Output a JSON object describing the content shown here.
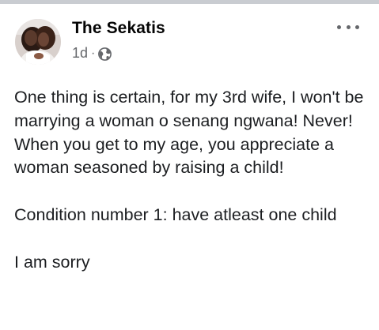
{
  "post": {
    "author": "The Sekatis",
    "time": "1d",
    "separator": "·",
    "privacy_icon": "globe-icon",
    "more_icon": "more-horizontal-icon",
    "paragraphs": [
      "One thing is certain, for my 3rd wife, I won't be marrying a woman o senang ngwana! Never! When you get to my age, you appreciate a woman seasoned by raising a child!",
      "Condition number 1: have atleast one child",
      "I am sorry"
    ]
  },
  "colors": {
    "text_primary": "#050505",
    "text_secondary": "#65676b",
    "top_strip": "#c9ccd1"
  }
}
